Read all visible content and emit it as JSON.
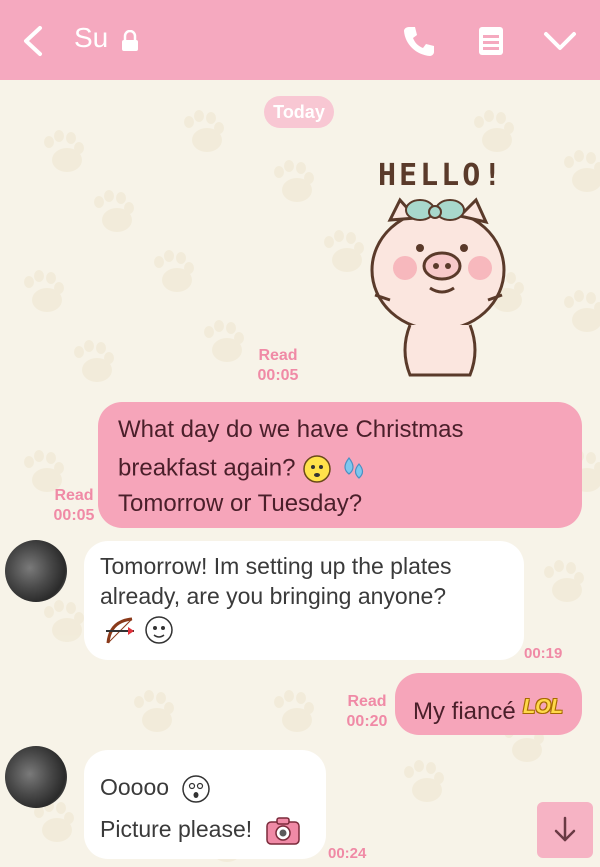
{
  "header": {
    "title": "Su",
    "colors": {
      "bar": "#f5a9bf",
      "icon": "#ffffff"
    }
  },
  "chat": {
    "date_label": "Today",
    "sticker": {
      "text": "HELLO!",
      "read_label": "Read",
      "time": "00:05"
    },
    "messages": [
      {
        "from": "me",
        "line1": "What day do we have Christmas",
        "line2": "breakfast again?",
        "line3": "Tomorrow or Tuesday?",
        "read_label": "Read",
        "time": "00:05"
      },
      {
        "from": "su",
        "line1": "Tomorrow! Im setting up the plates",
        "line2": "already, are you bringing anyone?",
        "time": "00:19"
      },
      {
        "from": "me",
        "text": "My fiancé",
        "sticker_text": "LOL",
        "read_label": "Read",
        "time": "00:20"
      },
      {
        "from": "su",
        "line1": "Ooooo",
        "line2": "Picture please!",
        "time": "00:24"
      }
    ]
  },
  "icons": [
    "back-arrow-icon",
    "lock-icon",
    "phone-icon",
    "menu-list-icon",
    "chevron-down-icon",
    "scroll-down-arrow-icon"
  ]
}
